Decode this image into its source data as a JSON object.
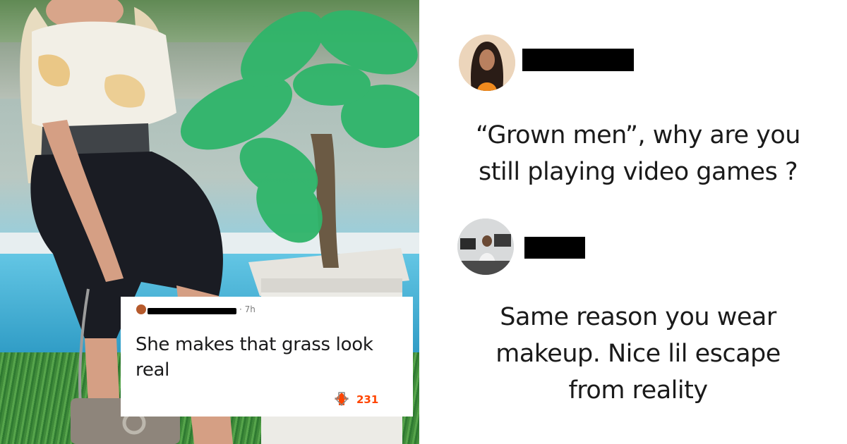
{
  "photo_comment": {
    "time": "· 7h",
    "text_line1": "She makes that grass look",
    "text_line2": "real",
    "votes": "231",
    "upvote_color": "#ff4500"
  },
  "post": {
    "text_line1": "“Grown men”, why are you",
    "text_line2": "still playing video games ?"
  },
  "reply": {
    "text_line1": "Same reason you wear",
    "text_line2": "makeup. Nice lil escape",
    "text_line3": "from reality"
  },
  "icons": {
    "upvote": "arrow-up-icon",
    "downvote": "arrow-down-icon"
  }
}
